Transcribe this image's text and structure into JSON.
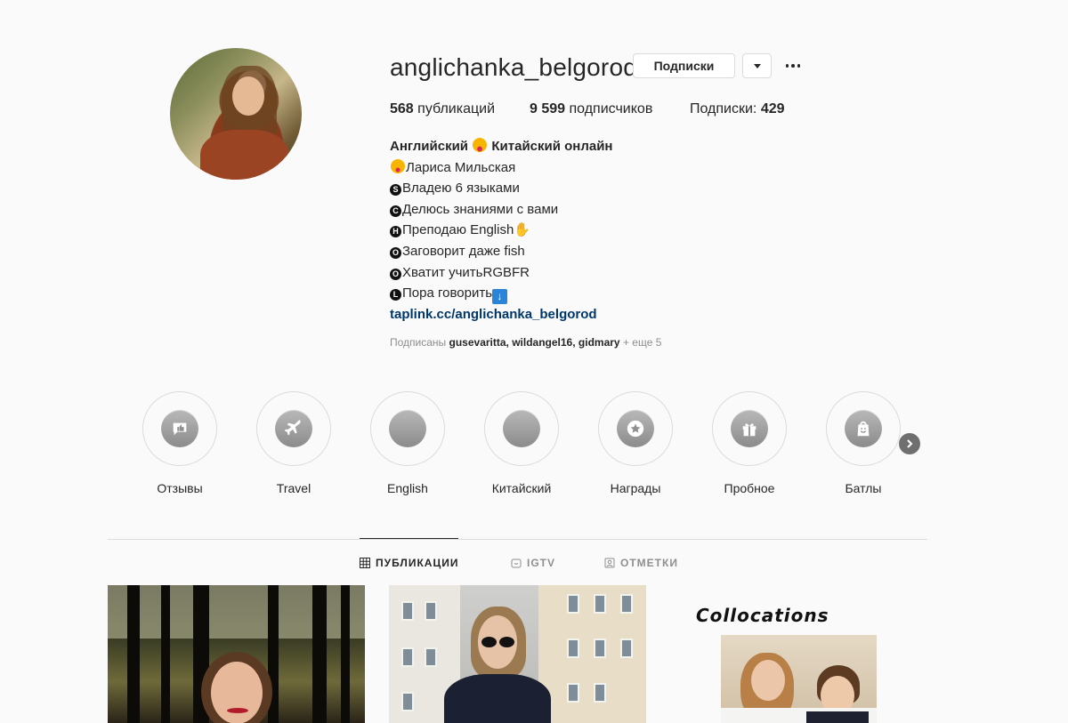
{
  "profile": {
    "username": "anglichanka_belgorod",
    "following_button": "Подписки",
    "stats": {
      "posts_count": "568",
      "posts_label": "публикаций",
      "followers_count": "9 599",
      "followers_label": "подписчиков",
      "following_label": "Подписки:",
      "following_count": "429"
    },
    "bio": {
      "name_part1": "Английский",
      "name_part2": "Китайский онлайн",
      "lines": [
        {
          "mark": "",
          "text": "Лариса Мильская"
        },
        {
          "mark": "S",
          "text": "Владею 6 языками"
        },
        {
          "mark": "C",
          "text": "Делюсь знаниями с вами"
        },
        {
          "mark": "H",
          "text": "Преподаю English"
        },
        {
          "mark": "O",
          "text": "Заговорит даже fish"
        },
        {
          "mark": "O",
          "text": "Хватит учитьRGBFR"
        },
        {
          "mark": "L",
          "text": "Пора говорить"
        }
      ],
      "link": "taplink.cc/anglichanka_belgorod"
    },
    "followed_by": {
      "prefix": "Подписаны",
      "names": "gusevaritta, wildangel16, gidmary",
      "more": "+ еще 5"
    }
  },
  "highlights": [
    {
      "label": "Отзывы",
      "icon": "chat-thumb-icon"
    },
    {
      "label": "Travel",
      "icon": "airplane-icon"
    },
    {
      "label": "English",
      "icon": "blank-icon"
    },
    {
      "label": "Китайский",
      "icon": "blank-icon"
    },
    {
      "label": "Награды",
      "icon": "star-icon"
    },
    {
      "label": "Пробное",
      "icon": "gift-icon"
    },
    {
      "label": "Батлы",
      "icon": "shopping-bag-icon"
    }
  ],
  "tabs": [
    {
      "label": "ПУБЛИКАЦИИ",
      "icon": "grid-icon",
      "active": true
    },
    {
      "label": "IGTV",
      "icon": "tv-icon",
      "active": false
    },
    {
      "label": "ОТМЕТКИ",
      "icon": "tag-icon",
      "active": false
    }
  ],
  "posts": [
    {
      "caption": ""
    },
    {
      "caption": ""
    },
    {
      "caption": "Collocations"
    }
  ],
  "colors": {
    "background": "#fafafa",
    "text": "#262626",
    "muted": "#8e8e8e",
    "link": "#00376b",
    "border": "#dbdbdb"
  }
}
